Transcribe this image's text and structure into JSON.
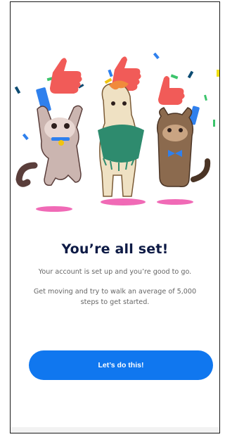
{
  "illustration": {
    "icon": "celebration-animals-icon"
  },
  "onboarding": {
    "title": "You’re all set!",
    "subtitle": "Your account is set up and you’re good to go.",
    "description": "Get moving and try to walk an average of 5,000 steps to get started.",
    "cta_label": "Let’s do this!"
  },
  "colors": {
    "title": "#0d1a45",
    "cta": "#1077ef",
    "thumb": "#f15b58"
  }
}
